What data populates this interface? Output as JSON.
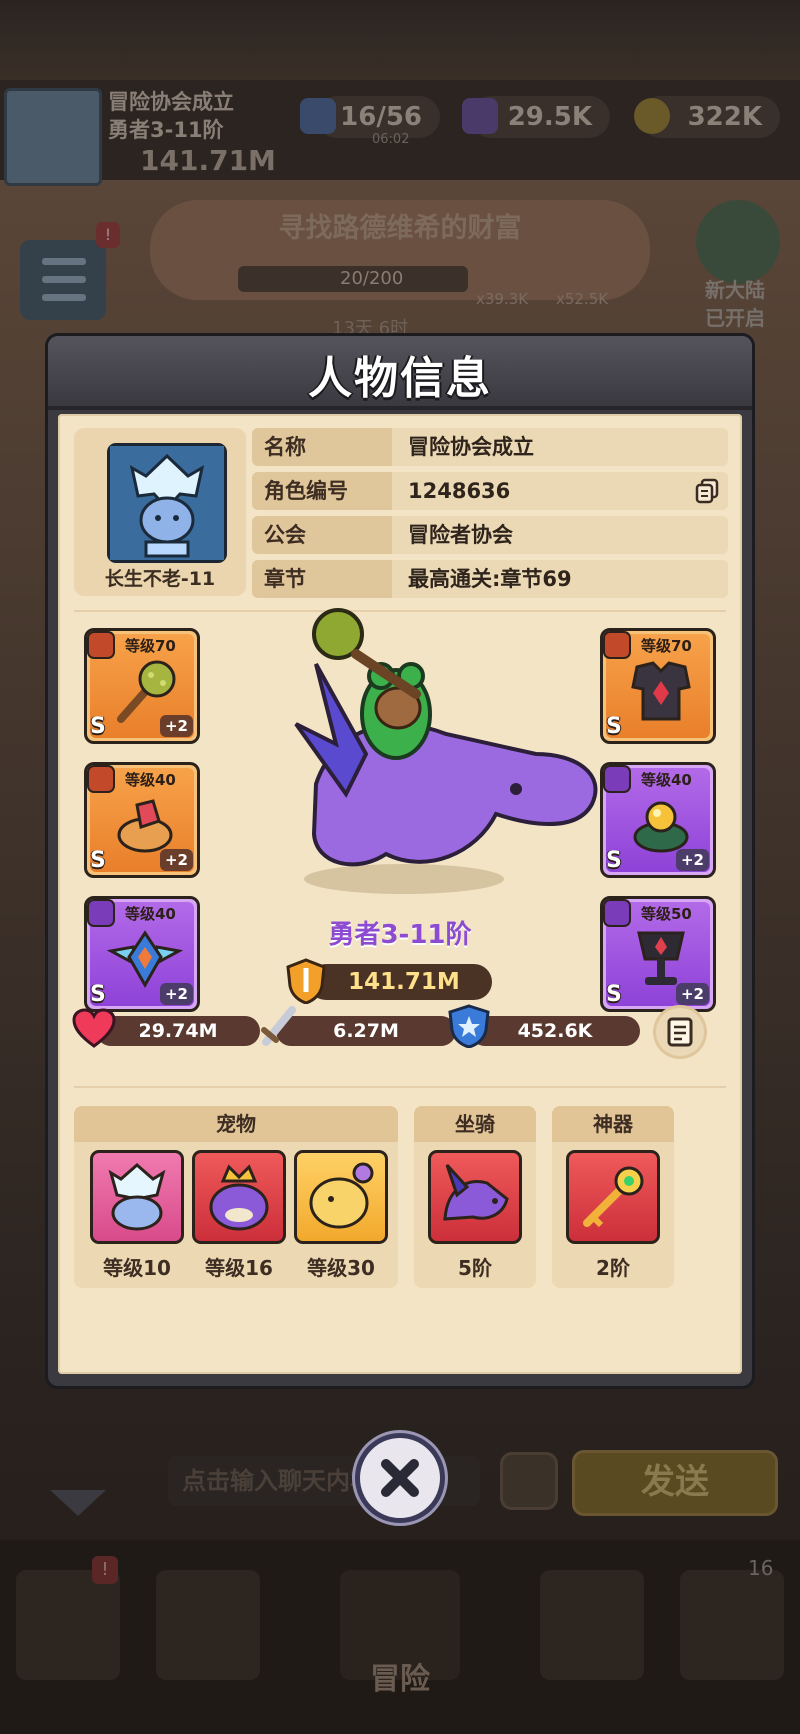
{
  "background": {
    "player_name": "冒险协会成立",
    "player_rank": "勇者3-11阶",
    "player_power": "141.71M",
    "resources": [
      {
        "value": "16/56",
        "sub": "06:02",
        "icon": "energy-icon"
      },
      {
        "value": "29.5K",
        "icon": "gem-icon"
      },
      {
        "value": "322K",
        "icon": "coin-icon"
      }
    ],
    "event_title": "寻找路德维希的财富",
    "event_progress": "20/200",
    "event_reward_1": "x39.3K",
    "event_reward_2": "x52.5K",
    "event_timer": "13天 6时",
    "menu_badge": "!",
    "new_continent_line1": "新大陆",
    "new_continent_line2": "已开启",
    "chat_placeholder": "点击输入聊天内容",
    "send_label": "发送",
    "nav_label": "冒险",
    "nav_badge": "!",
    "nav_count": "16"
  },
  "modal": {
    "title": "人物信息",
    "avatar_label": "长生不老-11",
    "info": [
      {
        "key": "名称",
        "value": "冒险协会成立"
      },
      {
        "key": "角色编号",
        "value": "1248636"
      },
      {
        "key": "公会",
        "value": "冒险者协会"
      },
      {
        "key": "章节",
        "value": "最高通关:章节69"
      }
    ],
    "equipment_left": [
      {
        "level": "等级70",
        "grade": "S",
        "plus": "+2",
        "rarity": "orange",
        "icon": "mace-icon"
      },
      {
        "level": "等级40",
        "grade": "S",
        "plus": "+2",
        "rarity": "orange",
        "icon": "ring-icon"
      },
      {
        "level": "等级40",
        "grade": "S",
        "plus": "+2",
        "rarity": "purple",
        "icon": "winged-amulet-icon"
      }
    ],
    "equipment_right": [
      {
        "level": "等级70",
        "grade": "S",
        "plus": "",
        "rarity": "orange",
        "icon": "armor-icon"
      },
      {
        "level": "等级40",
        "grade": "S",
        "plus": "+2",
        "rarity": "purple",
        "icon": "gem-ring-icon"
      },
      {
        "level": "等级50",
        "grade": "S",
        "plus": "+2",
        "rarity": "purple",
        "icon": "chalice-icon"
      }
    ],
    "rank": "勇者3-11阶",
    "power": "141.71M",
    "stats": {
      "hp": "29.74M",
      "attack": "6.27M",
      "defense": "452.6K"
    },
    "sections": {
      "pet_title": "宠物",
      "pets": [
        {
          "label": "等级10",
          "icon": "ice-slime-icon"
        },
        {
          "label": "等级16",
          "icon": "king-blob-icon"
        },
        {
          "label": "等级30",
          "icon": "golden-beast-icon"
        }
      ],
      "mount_title": "坐骑",
      "mount": {
        "label": "5阶",
        "icon": "dragon-icon"
      },
      "artifact_title": "神器",
      "artifact": {
        "label": "2阶",
        "icon": "key-icon"
      }
    }
  },
  "colors": {
    "panel": "#f3e4c6",
    "header": "#3b3a40",
    "rank_purple": "#8c4bd0",
    "power_gold": "#ffe08a"
  }
}
